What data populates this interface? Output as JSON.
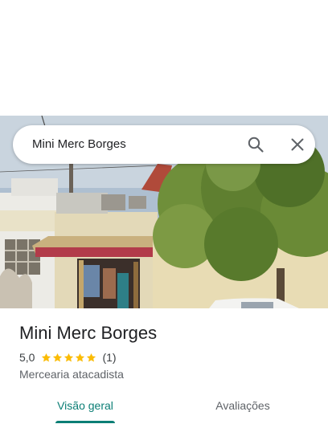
{
  "search": {
    "query": "Mini Merc Borges",
    "search_icon": "search-icon",
    "close_icon": "close-icon"
  },
  "place": {
    "name": "Mini Merc Borges",
    "rating": "5,0",
    "rating_stars": 5,
    "review_count": "(1)",
    "category": "Mercearia atacadista"
  },
  "tabs": [
    {
      "label": "Visão geral",
      "active": true
    },
    {
      "label": "Avaliações",
      "active": false
    }
  ],
  "colors": {
    "accent": "#0b7e75",
    "star": "#fbbc04",
    "title_text": "#202124",
    "secondary_text": "#5f6368"
  }
}
